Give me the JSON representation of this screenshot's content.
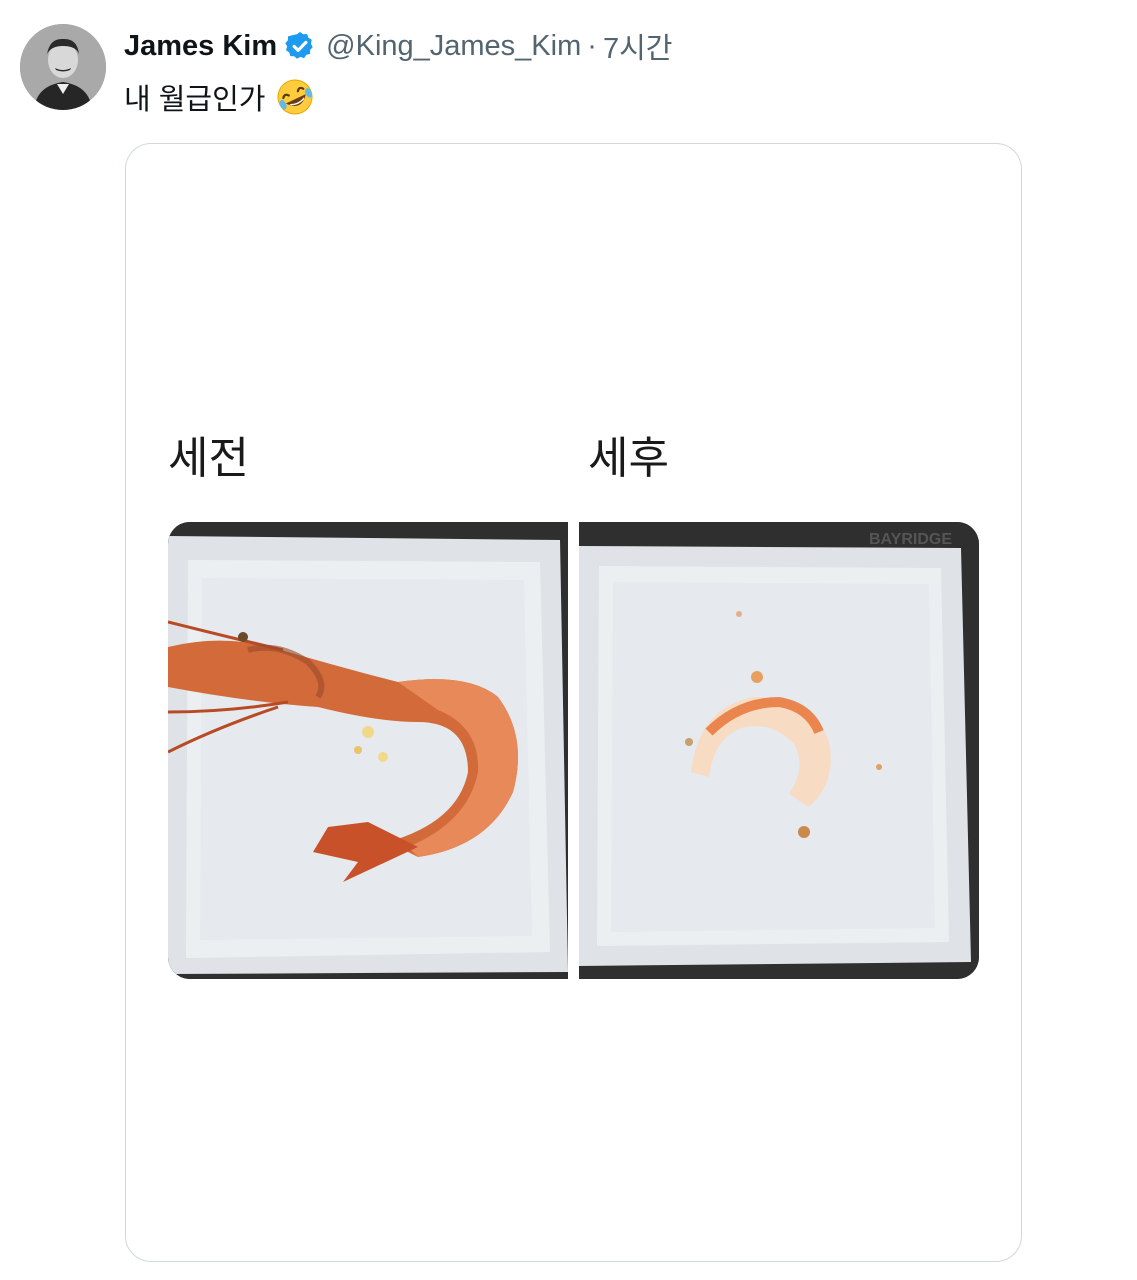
{
  "tweet": {
    "author_name": "James Kim",
    "handle": "@King_James_Kim",
    "separator": "·",
    "time": "7시간",
    "text": "내 월급인가",
    "emoji_icon": "rolling-on-floor-laughing-emoji"
  },
  "media": {
    "label_before": "세전",
    "label_after": "세후",
    "watermark": "BAYRIDGE"
  },
  "colors": {
    "verified": "#1d9bf0",
    "secondary_text": "#536471",
    "card_border": "#cfd9de"
  }
}
